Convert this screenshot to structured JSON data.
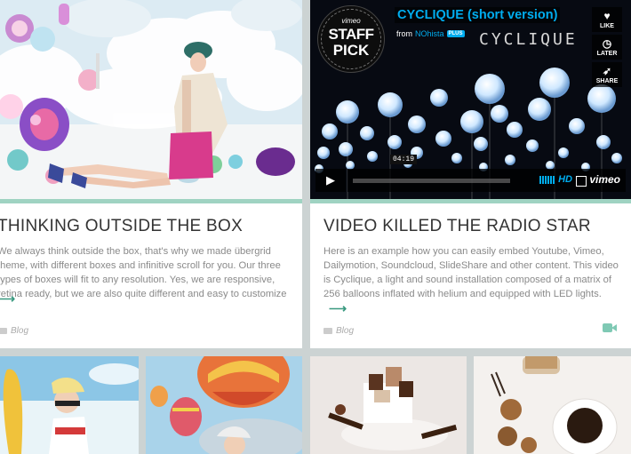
{
  "cards": [
    {
      "title": "THINKING OUTSIDE THE BOX",
      "excerpt": "We always think outside the box, that's why we made übergrid theme, with different boxes and infinitive scroll for you. Our three types of boxes will fit to any resolution. Yes, we are responsive, retina ready, but we are also quite different and easy to customize",
      "category": "Blog",
      "read_more": "⟶"
    },
    {
      "title": "VIDEO KILLED THE RADIO STAR",
      "excerpt": "Here is an example how you can easily embed Youtube, Vimeo, Dailymotion, Soundcloud, SlideShare and other content. This video is Cyclique, a light and sound installation composed of a matrix of 256 balloons inflated with helium and equipped with LED lights.",
      "category": "Blog",
      "read_more": "⟶"
    }
  ],
  "video": {
    "badge_top": "vimeo",
    "badge_line1": "STAFF",
    "badge_line2": "PICK",
    "title": "CYCLIQUE (short version)",
    "from_label": "from",
    "author": "NOhista",
    "plus": "PLUS",
    "logo_text": "CYCLIQUE",
    "timecode": "04:19",
    "hd": "HD",
    "vimeo_logo": "vimeo",
    "buttons": [
      {
        "label": "LIKE",
        "icon": "heart-icon"
      },
      {
        "label": "LATER",
        "icon": "clock-icon"
      },
      {
        "label": "SHARE",
        "icon": "share-icon"
      }
    ]
  },
  "colors": {
    "accent": "#9fd3c2",
    "link": "#3a9a80",
    "vimeo_blue": "#00adef",
    "background": "#ccd3d3"
  }
}
